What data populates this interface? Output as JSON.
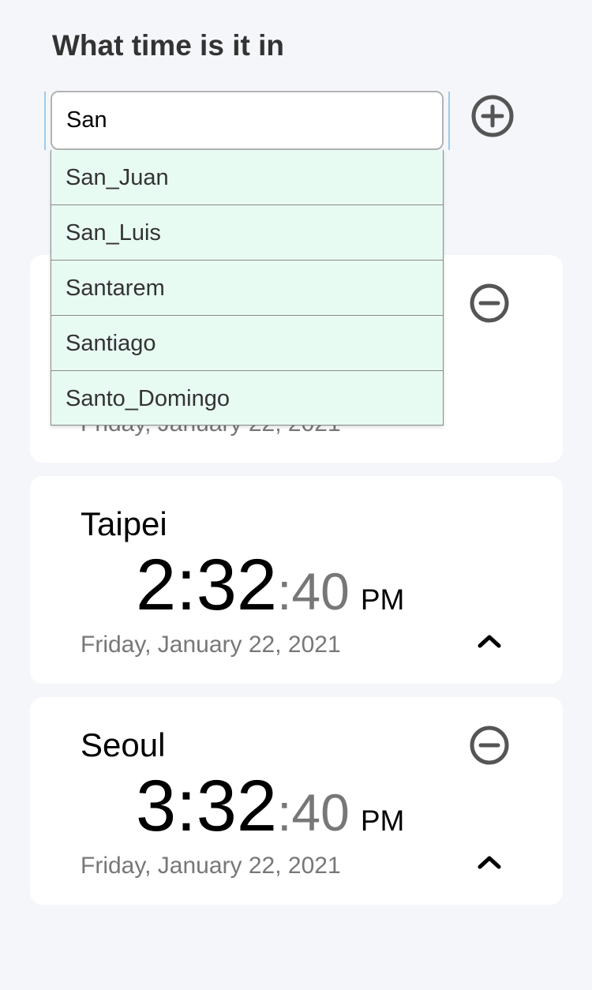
{
  "header": {
    "title": "What time is it in"
  },
  "search": {
    "value": "San",
    "suggestions": [
      "San_Juan",
      "San_Luis",
      "Santarem",
      "Santiago",
      "Santo_Domingo"
    ]
  },
  "cards": [
    {
      "date": "Friday, January 22, 2021"
    },
    {
      "city": "Taipei",
      "time_main": "2:32",
      "seconds": ":40",
      "ampm": "PM",
      "date": "Friday, January 22, 2021"
    },
    {
      "city": "Seoul",
      "time_main": "3:32",
      "seconds": ":40",
      "ampm": "PM",
      "date": "Friday, January 22, 2021"
    }
  ],
  "icons": {
    "add": "plus-circle-icon",
    "remove": "minus-circle-icon",
    "collapse": "chevron-up-icon"
  },
  "colors": {
    "background": "#f5f6fa",
    "dropdown_bg": "#e8fbf3",
    "icon": "#555555",
    "secondary_text": "#777777",
    "focus_ring": "#9ecbf0"
  }
}
